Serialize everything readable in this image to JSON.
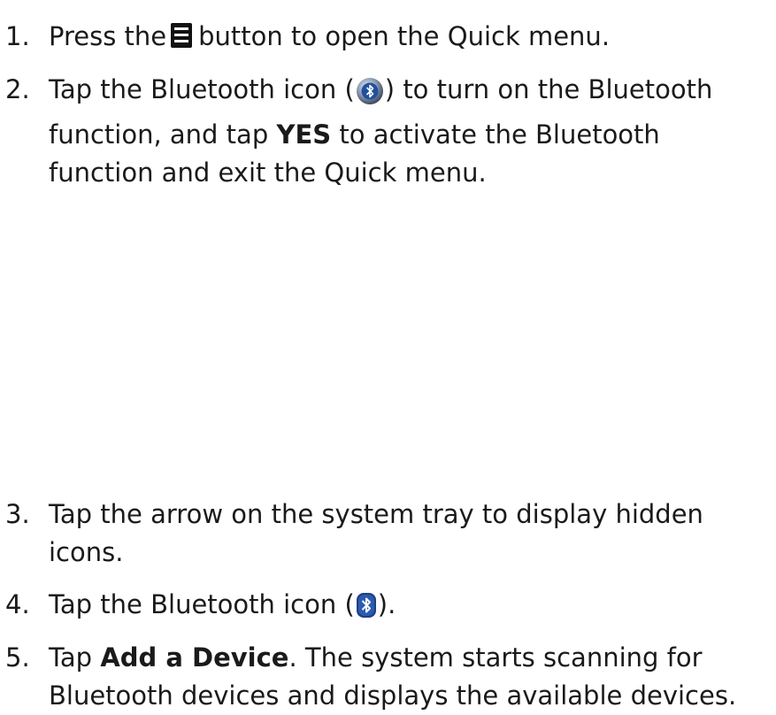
{
  "steps": [
    {
      "number": "1.",
      "before_icon": "Press the",
      "icon": "quick-menu-button-icon",
      "after_icon": "button to open the Quick menu."
    },
    {
      "number": "2.",
      "line1_before_icon": "Tap the Bluetooth icon (",
      "icon": "bluetooth-round-icon",
      "line1_after_icon": ") to turn on the Bluetooth",
      "line2_before_bold": "function, and tap ",
      "bold": "YES",
      "line2_after_bold": " to activate the Bluetooth",
      "line3": "function and exit the Quick menu."
    },
    {
      "number": "3.",
      "line1": "Tap the arrow on the system tray to display hidden",
      "line2": "icons."
    },
    {
      "number": "4.",
      "before_icon": "Tap the Bluetooth icon (",
      "icon": "bluetooth-tray-icon",
      "after_icon": ")."
    },
    {
      "number": "5.",
      "line1_before_bold": "Tap ",
      "bold": "Add a Device",
      "line1_after_bold": ". The system starts scanning for",
      "line2": "Bluetooth devices and displays the available devices."
    }
  ],
  "colors": {
    "text": "#1a1a1a",
    "bluetooth_blue": "#1f4fa0",
    "icon_dark": "#111111"
  }
}
